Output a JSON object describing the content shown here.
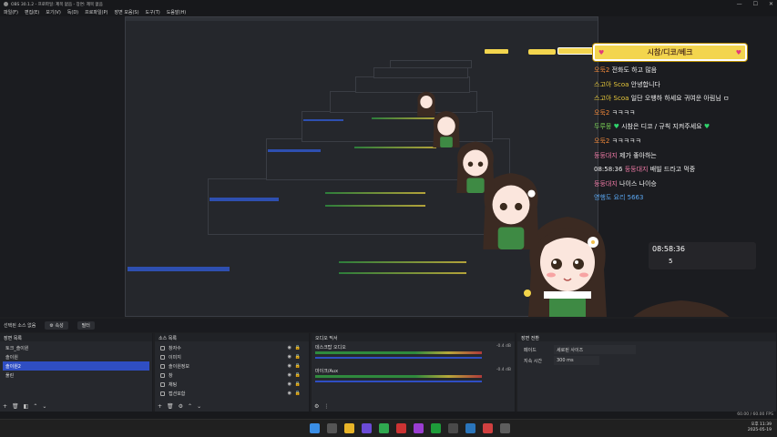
{
  "window": {
    "title": "OBS 30.1.2 - 프로파일: 제목 없음 - 장면: 제목 없음",
    "controls": [
      "—",
      "☐",
      "✕"
    ]
  },
  "menu": [
    "파일(F)",
    "편집(E)",
    "보기(V)",
    "독(D)",
    "프로파일(P)",
    "장면 모음(S)",
    "도구(T)",
    "도움말(H)"
  ],
  "chat": {
    "header": "시참/디코/베크",
    "lines": [
      {
        "user": "오둑2",
        "msg": "전화도 하고 많음",
        "cls": "u-orange"
      },
      {
        "user": "스고아 Scoa",
        "msg": "안녕합니다",
        "cls": "u-yellow"
      },
      {
        "user": "스고아 Scoa",
        "msg": "일단 오뱅하 하세요 귀여운 아림님 ㅁ",
        "cls": "u-yellow"
      },
      {
        "user": "오둑2",
        "msg": "ㅋㅋㅋㅋ",
        "cls": "u-orange"
      },
      {
        "user": "두루뭉",
        "msg": "시참은 디코 / 규칙 지켜주세요",
        "cls": "u-green"
      },
      {
        "user": "오둑2",
        "msg": "ㅋㅋㅋㅋㅋ",
        "cls": "u-orange"
      },
      {
        "user": "둥둥대지",
        "msg": "제가 좋아하는",
        "cls": "u-pink"
      },
      {
        "user": "둥둥대지",
        "msg": "배빌 드라고 먹중",
        "cls": "u-pink"
      },
      {
        "user": "둥둥대지",
        "msg": "나이스 나이승",
        "cls": "u-pink"
      },
      {
        "user": "영행도 요리 5663",
        "msg": "",
        "cls": "u-blue"
      }
    ],
    "time": "08:58:36",
    "time_prefix": "08:58:36",
    "count": "5"
  },
  "context": {
    "label": "선택된 소스 없음",
    "props": "속성",
    "filters": "필터"
  },
  "scenes": {
    "title": "장면 목록",
    "items": [
      "토크_솔이원",
      "솔이원",
      "솔이원2",
      "풀린"
    ],
    "selected": 2
  },
  "sources": {
    "title": "소스 목록",
    "items": [
      "창자수",
      "이미지",
      "솔이원정보",
      "창",
      "채팅",
      "캡션포함"
    ]
  },
  "mixer": {
    "title": "오디오 믹서",
    "channels": [
      {
        "name": "데스크탑 오디오",
        "db": "-0.4 dB"
      },
      {
        "name": "마이크/Aux",
        "db": "-0.4 dB"
      }
    ]
  },
  "transitions": {
    "title": "장면 전환",
    "type_label": "페이드",
    "type_value": "세로된 사이즈",
    "duration_label": "지속 시간",
    "duration_value": "300 ms"
  },
  "status": {
    "fps": "60.00 / 60.00 FPS"
  },
  "clock": {
    "time": "오후 11:39",
    "date": "2025-05-19"
  }
}
